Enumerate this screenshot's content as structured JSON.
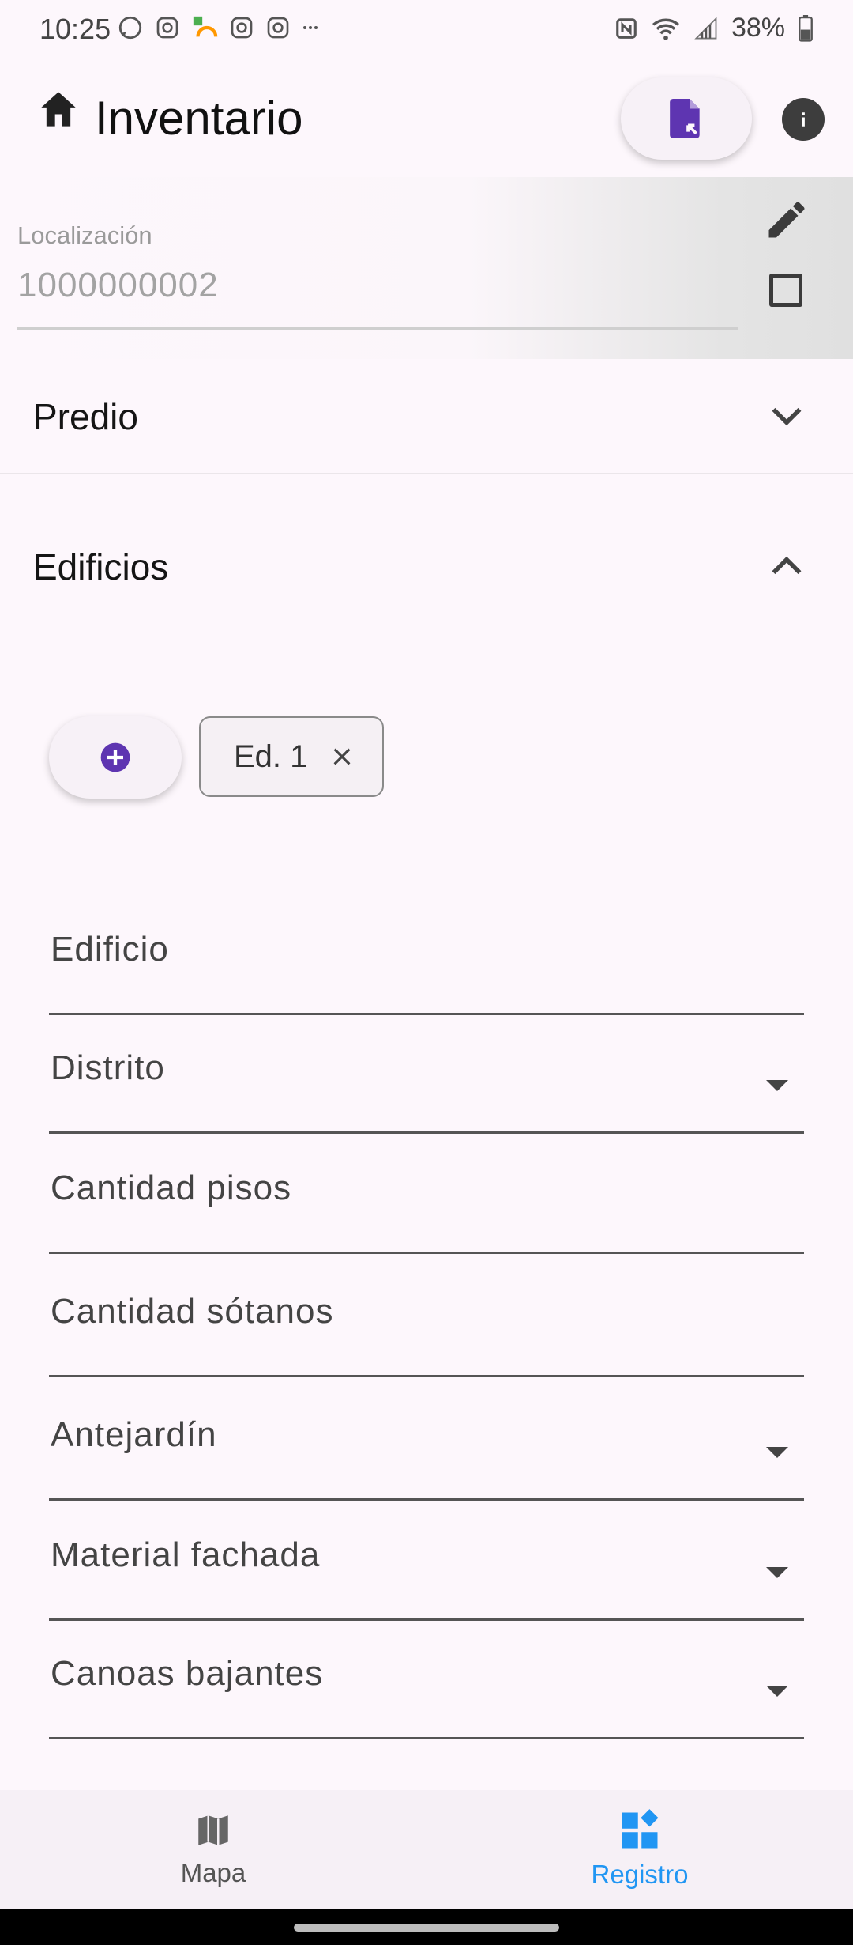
{
  "status_bar": {
    "time": "10:25",
    "battery": "38%"
  },
  "app_bar": {
    "title": "Inventario",
    "icons": [
      "home-icon",
      "file-export-icon",
      "info-icon"
    ]
  },
  "location": {
    "label": "Localización",
    "value": "1000000002"
  },
  "sections": {
    "predio": "Predio",
    "edificios": "Edificios"
  },
  "buildings": {
    "chips": [
      {
        "label": "Ed. 1"
      }
    ]
  },
  "fields": [
    {
      "label": "Edificio",
      "dropdown": false
    },
    {
      "label": "Distrito",
      "dropdown": true
    },
    {
      "label": "Cantidad pisos",
      "dropdown": false
    },
    {
      "label": "Cantidad sótanos",
      "dropdown": false
    },
    {
      "label": "Antejardín",
      "dropdown": true
    },
    {
      "label": "Material fachada",
      "dropdown": true
    },
    {
      "label": "Canoas bajantes",
      "dropdown": true
    }
  ],
  "bottom_nav": {
    "items": [
      {
        "label": "Mapa",
        "icon": "map-icon",
        "active": false
      },
      {
        "label": "Registro",
        "icon": "dashboard-icon",
        "active": true
      }
    ]
  },
  "colors": {
    "accent": "#5e35b1",
    "nav_active": "#2196f3",
    "background": "#fdf7fc"
  }
}
